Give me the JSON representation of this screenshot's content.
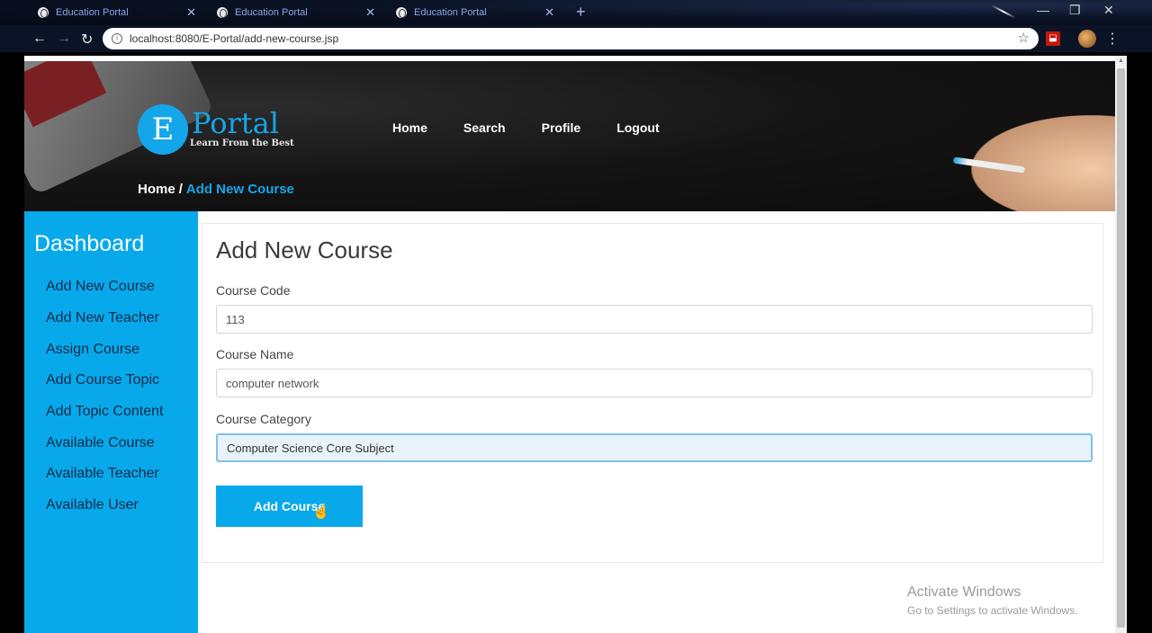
{
  "browser": {
    "tabs": [
      {
        "title": "Education Portal"
      },
      {
        "title": "Education Portal"
      },
      {
        "title": "Education Portal"
      }
    ],
    "url": "localhost:8080/E-Portal/add-new-course.jsp"
  },
  "header": {
    "logo_letter": "E",
    "logo_word": "Portal",
    "logo_tagline": "Learn From the Best",
    "nav": [
      "Home",
      "Search",
      "Profile",
      "Logout"
    ],
    "breadcrumb": {
      "home": "Home",
      "separator": "/",
      "current": "Add New Course"
    }
  },
  "sidebar": {
    "title": "Dashboard",
    "items": [
      "Add New Course",
      "Add New Teacher",
      "Assign Course",
      "Add Course Topic",
      "Add Topic Content",
      "Available Course",
      "Available Teacher",
      "Available User"
    ]
  },
  "form": {
    "title": "Add New Course",
    "course_code_label": "Course Code",
    "course_code_value": "113",
    "course_name_label": "Course Name",
    "course_name_value": "computer network",
    "course_category_label": "Course Category",
    "course_category_value": "Computer Science Core Subject",
    "submit_label": "Add Course"
  },
  "watermark": {
    "line1": "Activate Windows",
    "line2": "Go to Settings to activate Windows."
  },
  "colors": {
    "accent": "#08a9ea",
    "sidebar_text": "#0b2a4a"
  }
}
